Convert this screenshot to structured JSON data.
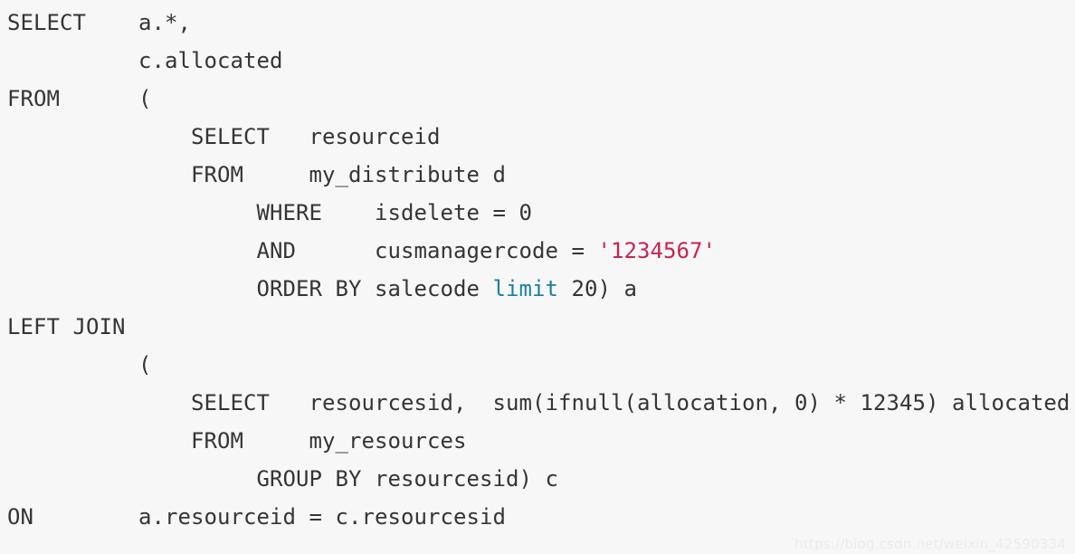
{
  "editor": {
    "background_color": "#f7f7f7",
    "text_color": "#353535",
    "string_color": "#c7254e",
    "keyword_color": "#1a7fa0",
    "language": "sql",
    "lines": [
      {
        "n": 1,
        "segments": [
          {
            "t": "SELECT    a.*,",
            "k": "plain"
          }
        ]
      },
      {
        "n": 2,
        "segments": [
          {
            "t": "          c.allocated",
            "k": "plain"
          }
        ]
      },
      {
        "n": 3,
        "segments": [
          {
            "t": "FROM      (",
            "k": "plain"
          }
        ]
      },
      {
        "n": 4,
        "segments": [
          {
            "t": "              SELECT   resourceid",
            "k": "plain"
          }
        ]
      },
      {
        "n": 5,
        "segments": [
          {
            "t": "              FROM     my_distribute d",
            "k": "plain"
          }
        ]
      },
      {
        "n": 6,
        "segments": [
          {
            "t": "                   WHERE    isdelete = 0",
            "k": "plain"
          }
        ]
      },
      {
        "n": 7,
        "segments": [
          {
            "t": "                   AND      cusmanagercode = ",
            "k": "plain"
          },
          {
            "t": "'1234567'",
            "k": "string"
          }
        ]
      },
      {
        "n": 8,
        "segments": [
          {
            "t": "                   ORDER BY salecode ",
            "k": "plain"
          },
          {
            "t": "limit",
            "k": "keyword"
          },
          {
            "t": " 20) a",
            "k": "plain"
          }
        ]
      },
      {
        "n": 9,
        "segments": [
          {
            "t": "LEFT JOIN",
            "k": "plain"
          }
        ]
      },
      {
        "n": 10,
        "segments": [
          {
            "t": "          (",
            "k": "plain"
          }
        ]
      },
      {
        "n": 11,
        "segments": [
          {
            "t": "              SELECT   resourcesid,  sum(ifnull(allocation, 0) * 12345) allocated",
            "k": "plain"
          }
        ]
      },
      {
        "n": 12,
        "segments": [
          {
            "t": "              FROM     my_resources",
            "k": "plain"
          }
        ]
      },
      {
        "n": 13,
        "segments": [
          {
            "t": "                   GROUP BY resourcesid) c",
            "k": "plain"
          }
        ]
      },
      {
        "n": 14,
        "segments": [
          {
            "t": "ON        a.resourceid = c.resourcesid",
            "k": "plain"
          }
        ]
      }
    ]
  },
  "watermark": {
    "text": "https://blog.csdn.net/weixin_42590334"
  }
}
